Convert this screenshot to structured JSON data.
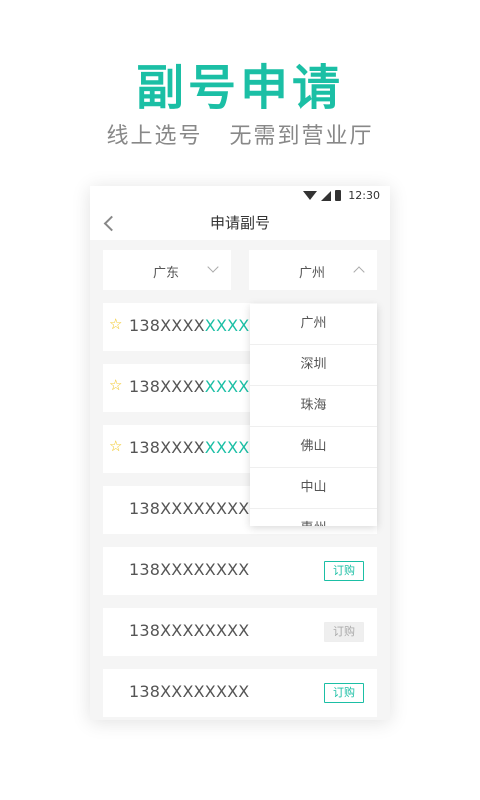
{
  "promo": {
    "headline": "副号申请",
    "subline": "线上选号   无需到营业厅"
  },
  "statusbar": {
    "time": "12:30"
  },
  "titlebar": {
    "title": "申请副号"
  },
  "filters": {
    "province": "广东",
    "city": "广州"
  },
  "city_options": [
    "广州",
    "深圳",
    "珠海",
    "佛山",
    "中山",
    "惠州"
  ],
  "numbers": [
    {
      "prefix": "138XXXX",
      "suffix": "XXXX",
      "starred": true
    },
    {
      "prefix": "138XXXX",
      "suffix": "XXXX",
      "starred": true
    },
    {
      "prefix": "138XXXX",
      "suffix": "XXXX",
      "starred": true
    },
    {
      "prefix": "138XXXXXXXX",
      "suffix": "",
      "starred": false
    },
    {
      "prefix": "138XXXXXXXX",
      "suffix": "",
      "starred": false,
      "button": "订购",
      "button_state": "active"
    },
    {
      "prefix": "138XXXXXXXX",
      "suffix": "",
      "starred": false,
      "button": "订购",
      "button_state": "disabled"
    },
    {
      "prefix": "138XXXXXXXX",
      "suffix": "",
      "starred": false,
      "button": "订购",
      "button_state": "active"
    }
  ],
  "icons": {
    "star": "★",
    "star_outline": "☆"
  },
  "colors": {
    "accent": "#1bbfa5",
    "star": "#f0c419"
  }
}
